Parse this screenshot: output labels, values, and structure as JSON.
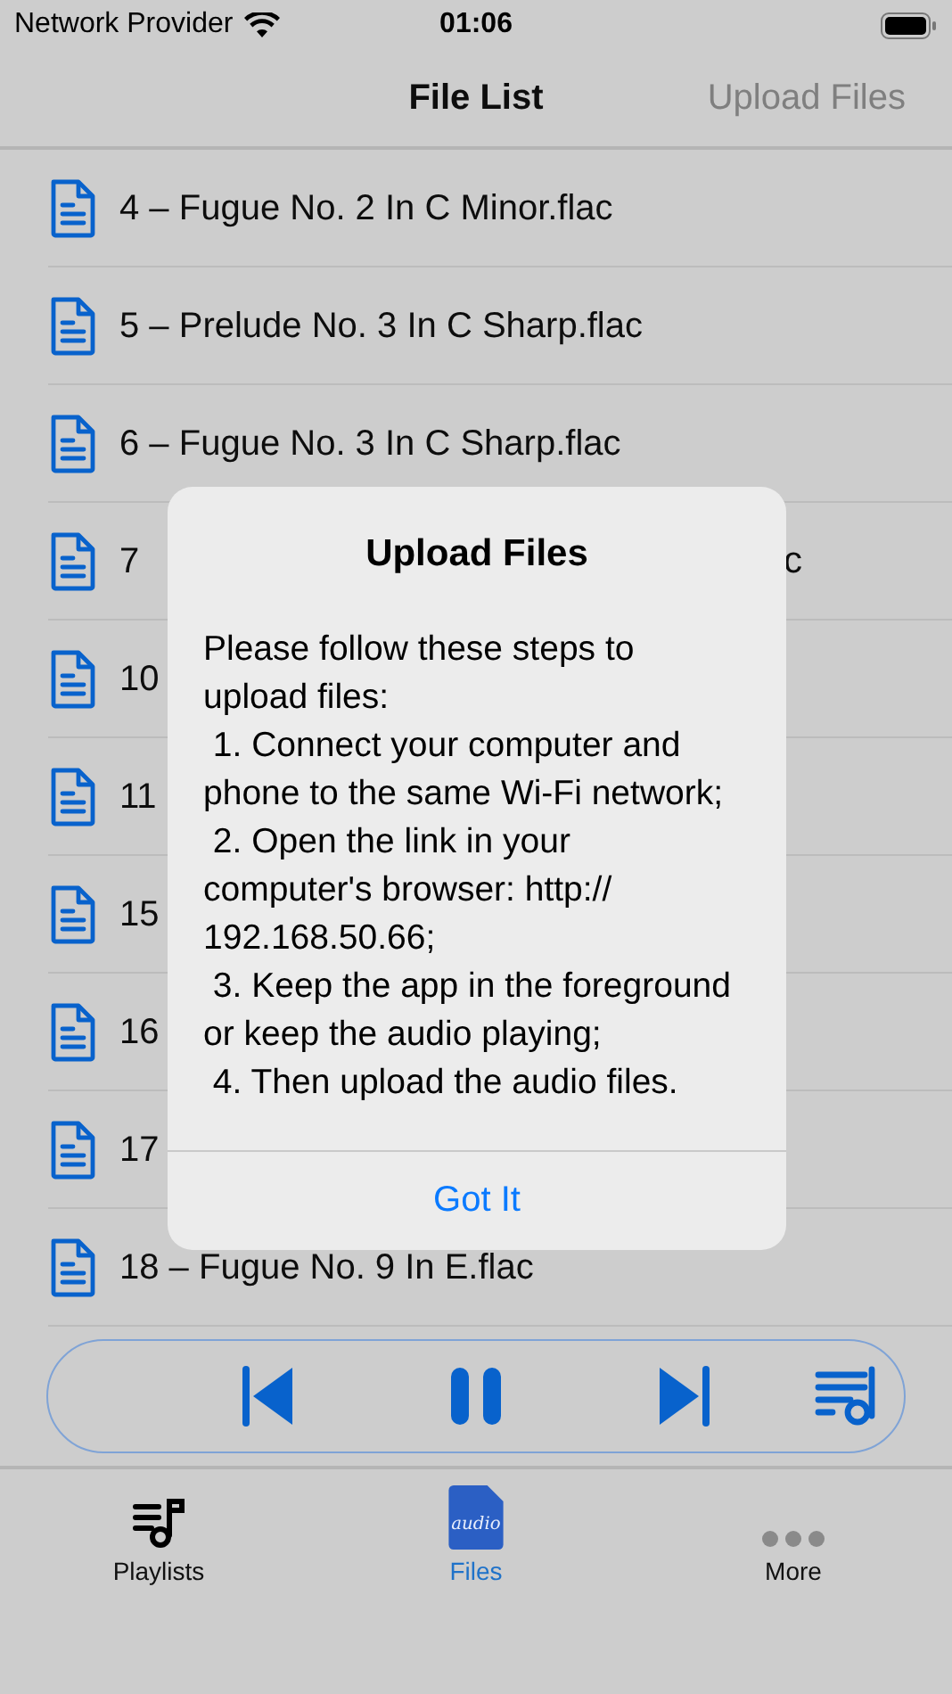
{
  "status_bar": {
    "carrier": "Network Provider",
    "time": "01:06"
  },
  "nav": {
    "title": "File List",
    "action": "Upload Files"
  },
  "files": [
    {
      "label": "4 – Fugue No. 2 In C Minor.flac"
    },
    {
      "label": "5 – Prelude No. 3 In C Sharp.flac"
    },
    {
      "label": "6 – Fugue No. 3 In C Sharp.flac"
    },
    {
      "label": "7",
      "tail": "c"
    },
    {
      "label": "10"
    },
    {
      "label": "11"
    },
    {
      "label": "15"
    },
    {
      "label": "16"
    },
    {
      "label": "17"
    },
    {
      "label": "18 – Fugue No. 9 In E.flac"
    }
  ],
  "player": {
    "playing": true
  },
  "dialog": {
    "title": "Upload Files",
    "message": "Please follow these steps to upload files:\n 1. Connect your computer and phone to the same Wi-Fi network;\n 2. Open the link in your computer's browser: http://\n192.168.50.66;\n 3. Keep the app in the foreground or keep the audio playing;\n 4. Then upload the audio files.",
    "button": "Got It"
  },
  "tabs": [
    {
      "kind": "playlists",
      "label": "Playlists",
      "selected": false
    },
    {
      "kind": "files",
      "label": "Files",
      "selected": true,
      "icon_text": "audio"
    },
    {
      "kind": "more",
      "label": "More",
      "selected": false
    }
  ]
}
